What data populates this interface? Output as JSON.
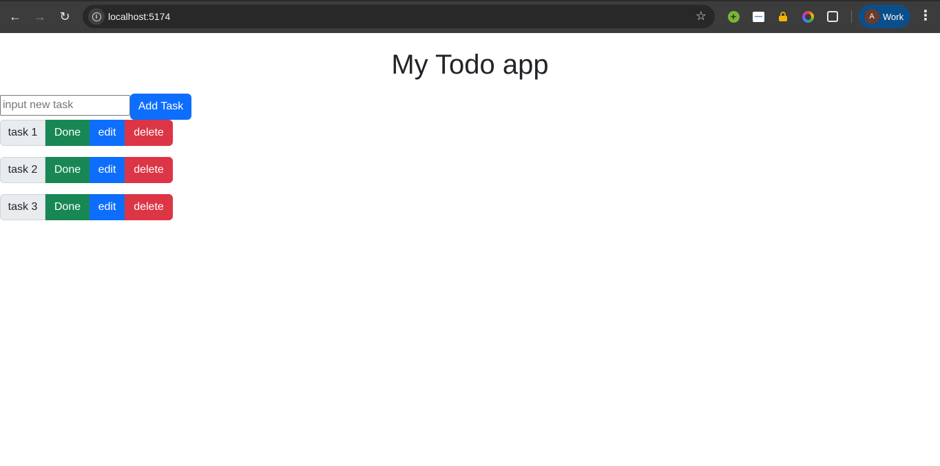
{
  "browser": {
    "url": "localhost:5174",
    "profile_initial": "A",
    "profile_label": "Work",
    "icons": {
      "back": "arrow-left-icon",
      "forward": "arrow-right-icon",
      "reload": "reload-icon",
      "site_info": "info-icon",
      "bookmark": "star-icon",
      "menu": "kebab-menu-icon"
    }
  },
  "app": {
    "title": "My Todo app",
    "input_placeholder": "input new task",
    "add_button_label": "Add Task",
    "tasks": [
      {
        "name": "task 1",
        "done_label": "Done",
        "edit_label": "edit",
        "delete_label": "delete"
      },
      {
        "name": "task 2",
        "done_label": "Done",
        "edit_label": "edit",
        "delete_label": "delete"
      },
      {
        "name": "task 3",
        "done_label": "Done",
        "edit_label": "edit",
        "delete_label": "delete"
      }
    ]
  },
  "colors": {
    "primary": "#0d6efd",
    "success": "#198754",
    "danger": "#dc3545",
    "task_label_bg": "#e9ecef"
  }
}
